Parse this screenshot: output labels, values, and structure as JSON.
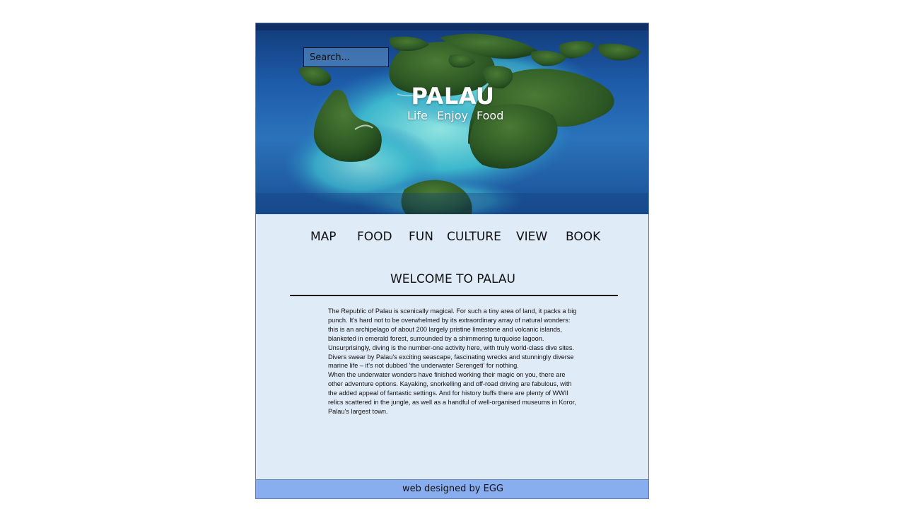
{
  "header": {
    "search_placeholder": "Search...",
    "title": "PALAU",
    "tagline": [
      "Life",
      "Enjoy",
      "Food"
    ]
  },
  "nav": {
    "items": [
      "MAP",
      "FOOD",
      "FUN",
      "CULTURE",
      "VIEW",
      "BOOK"
    ]
  },
  "main": {
    "heading": "WELCOME TO PALAU",
    "paragraphs": [
      "The Republic of Palau is scenically magical. For such a tiny area of land, it packs a big punch. It's hard not to be overwhelmed by its extraordinary array of natural wonders: this is an archipelago of about 200 largely pristine limestone and volcanic islands, blanketed in emerald forest, surrounded by a shimmering turquoise lagoon. Unsurprisingly, diving is the number-one activity here, with truly world-class dive sites. Divers swear by Palau's exciting seascape, fascinating wrecks and stunningly diverse marine life – it's not dubbed 'the underwater Serengeti' for nothing.",
      "When the underwater wonders have finished working their magic on you, there are other adventure options. Kayaking, snorkelling and off-road driving are fabulous, with the added appeal of fantastic settings. And for history buffs there are plenty of WWII relics scattered in the jungle, as well as a handful of well-organised museums in Koror, Palau's largest town."
    ]
  },
  "footer": {
    "text": "web designed  by EGG"
  },
  "colors": {
    "page_background": "#e0ebf8",
    "footer_background": "#88aef0",
    "hero_ocean": "#1d5aa8",
    "lagoon": "#4cc3d0",
    "island_green": "#2f5d2a"
  }
}
